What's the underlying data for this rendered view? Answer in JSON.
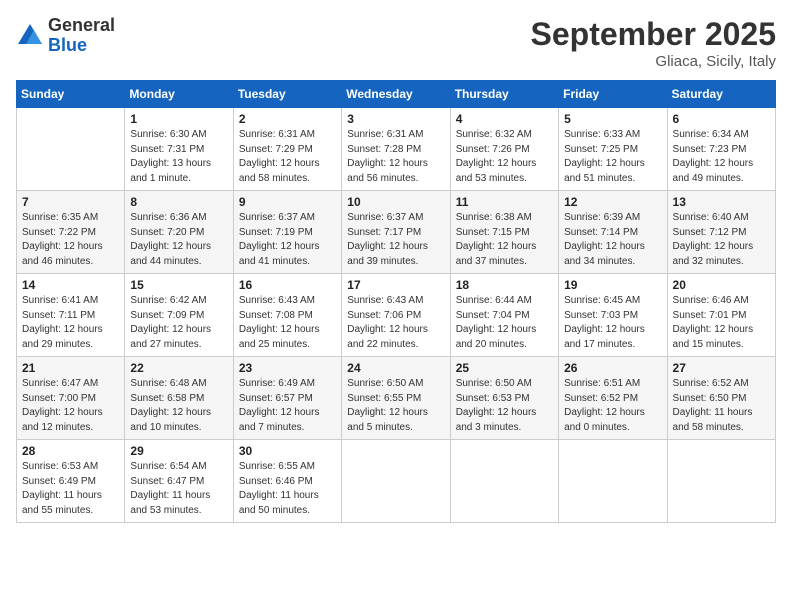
{
  "header": {
    "logo_line1": "General",
    "logo_line2": "Blue",
    "month": "September 2025",
    "location": "Gliaca, Sicily, Italy"
  },
  "weekdays": [
    "Sunday",
    "Monday",
    "Tuesday",
    "Wednesday",
    "Thursday",
    "Friday",
    "Saturday"
  ],
  "weeks": [
    [
      {
        "day": "",
        "sunrise": "",
        "sunset": "",
        "daylight": ""
      },
      {
        "day": "1",
        "sunrise": "Sunrise: 6:30 AM",
        "sunset": "Sunset: 7:31 PM",
        "daylight": "Daylight: 13 hours and 1 minute."
      },
      {
        "day": "2",
        "sunrise": "Sunrise: 6:31 AM",
        "sunset": "Sunset: 7:29 PM",
        "daylight": "Daylight: 12 hours and 58 minutes."
      },
      {
        "day": "3",
        "sunrise": "Sunrise: 6:31 AM",
        "sunset": "Sunset: 7:28 PM",
        "daylight": "Daylight: 12 hours and 56 minutes."
      },
      {
        "day": "4",
        "sunrise": "Sunrise: 6:32 AM",
        "sunset": "Sunset: 7:26 PM",
        "daylight": "Daylight: 12 hours and 53 minutes."
      },
      {
        "day": "5",
        "sunrise": "Sunrise: 6:33 AM",
        "sunset": "Sunset: 7:25 PM",
        "daylight": "Daylight: 12 hours and 51 minutes."
      },
      {
        "day": "6",
        "sunrise": "Sunrise: 6:34 AM",
        "sunset": "Sunset: 7:23 PM",
        "daylight": "Daylight: 12 hours and 49 minutes."
      }
    ],
    [
      {
        "day": "7",
        "sunrise": "Sunrise: 6:35 AM",
        "sunset": "Sunset: 7:22 PM",
        "daylight": "Daylight: 12 hours and 46 minutes."
      },
      {
        "day": "8",
        "sunrise": "Sunrise: 6:36 AM",
        "sunset": "Sunset: 7:20 PM",
        "daylight": "Daylight: 12 hours and 44 minutes."
      },
      {
        "day": "9",
        "sunrise": "Sunrise: 6:37 AM",
        "sunset": "Sunset: 7:19 PM",
        "daylight": "Daylight: 12 hours and 41 minutes."
      },
      {
        "day": "10",
        "sunrise": "Sunrise: 6:37 AM",
        "sunset": "Sunset: 7:17 PM",
        "daylight": "Daylight: 12 hours and 39 minutes."
      },
      {
        "day": "11",
        "sunrise": "Sunrise: 6:38 AM",
        "sunset": "Sunset: 7:15 PM",
        "daylight": "Daylight: 12 hours and 37 minutes."
      },
      {
        "day": "12",
        "sunrise": "Sunrise: 6:39 AM",
        "sunset": "Sunset: 7:14 PM",
        "daylight": "Daylight: 12 hours and 34 minutes."
      },
      {
        "day": "13",
        "sunrise": "Sunrise: 6:40 AM",
        "sunset": "Sunset: 7:12 PM",
        "daylight": "Daylight: 12 hours and 32 minutes."
      }
    ],
    [
      {
        "day": "14",
        "sunrise": "Sunrise: 6:41 AM",
        "sunset": "Sunset: 7:11 PM",
        "daylight": "Daylight: 12 hours and 29 minutes."
      },
      {
        "day": "15",
        "sunrise": "Sunrise: 6:42 AM",
        "sunset": "Sunset: 7:09 PM",
        "daylight": "Daylight: 12 hours and 27 minutes."
      },
      {
        "day": "16",
        "sunrise": "Sunrise: 6:43 AM",
        "sunset": "Sunset: 7:08 PM",
        "daylight": "Daylight: 12 hours and 25 minutes."
      },
      {
        "day": "17",
        "sunrise": "Sunrise: 6:43 AM",
        "sunset": "Sunset: 7:06 PM",
        "daylight": "Daylight: 12 hours and 22 minutes."
      },
      {
        "day": "18",
        "sunrise": "Sunrise: 6:44 AM",
        "sunset": "Sunset: 7:04 PM",
        "daylight": "Daylight: 12 hours and 20 minutes."
      },
      {
        "day": "19",
        "sunrise": "Sunrise: 6:45 AM",
        "sunset": "Sunset: 7:03 PM",
        "daylight": "Daylight: 12 hours and 17 minutes."
      },
      {
        "day": "20",
        "sunrise": "Sunrise: 6:46 AM",
        "sunset": "Sunset: 7:01 PM",
        "daylight": "Daylight: 12 hours and 15 minutes."
      }
    ],
    [
      {
        "day": "21",
        "sunrise": "Sunrise: 6:47 AM",
        "sunset": "Sunset: 7:00 PM",
        "daylight": "Daylight: 12 hours and 12 minutes."
      },
      {
        "day": "22",
        "sunrise": "Sunrise: 6:48 AM",
        "sunset": "Sunset: 6:58 PM",
        "daylight": "Daylight: 12 hours and 10 minutes."
      },
      {
        "day": "23",
        "sunrise": "Sunrise: 6:49 AM",
        "sunset": "Sunset: 6:57 PM",
        "daylight": "Daylight: 12 hours and 7 minutes."
      },
      {
        "day": "24",
        "sunrise": "Sunrise: 6:50 AM",
        "sunset": "Sunset: 6:55 PM",
        "daylight": "Daylight: 12 hours and 5 minutes."
      },
      {
        "day": "25",
        "sunrise": "Sunrise: 6:50 AM",
        "sunset": "Sunset: 6:53 PM",
        "daylight": "Daylight: 12 hours and 3 minutes."
      },
      {
        "day": "26",
        "sunrise": "Sunrise: 6:51 AM",
        "sunset": "Sunset: 6:52 PM",
        "daylight": "Daylight: 12 hours and 0 minutes."
      },
      {
        "day": "27",
        "sunrise": "Sunrise: 6:52 AM",
        "sunset": "Sunset: 6:50 PM",
        "daylight": "Daylight: 11 hours and 58 minutes."
      }
    ],
    [
      {
        "day": "28",
        "sunrise": "Sunrise: 6:53 AM",
        "sunset": "Sunset: 6:49 PM",
        "daylight": "Daylight: 11 hours and 55 minutes."
      },
      {
        "day": "29",
        "sunrise": "Sunrise: 6:54 AM",
        "sunset": "Sunset: 6:47 PM",
        "daylight": "Daylight: 11 hours and 53 minutes."
      },
      {
        "day": "30",
        "sunrise": "Sunrise: 6:55 AM",
        "sunset": "Sunset: 6:46 PM",
        "daylight": "Daylight: 11 hours and 50 minutes."
      },
      {
        "day": "",
        "sunrise": "",
        "sunset": "",
        "daylight": ""
      },
      {
        "day": "",
        "sunrise": "",
        "sunset": "",
        "daylight": ""
      },
      {
        "day": "",
        "sunrise": "",
        "sunset": "",
        "daylight": ""
      },
      {
        "day": "",
        "sunrise": "",
        "sunset": "",
        "daylight": ""
      }
    ]
  ]
}
